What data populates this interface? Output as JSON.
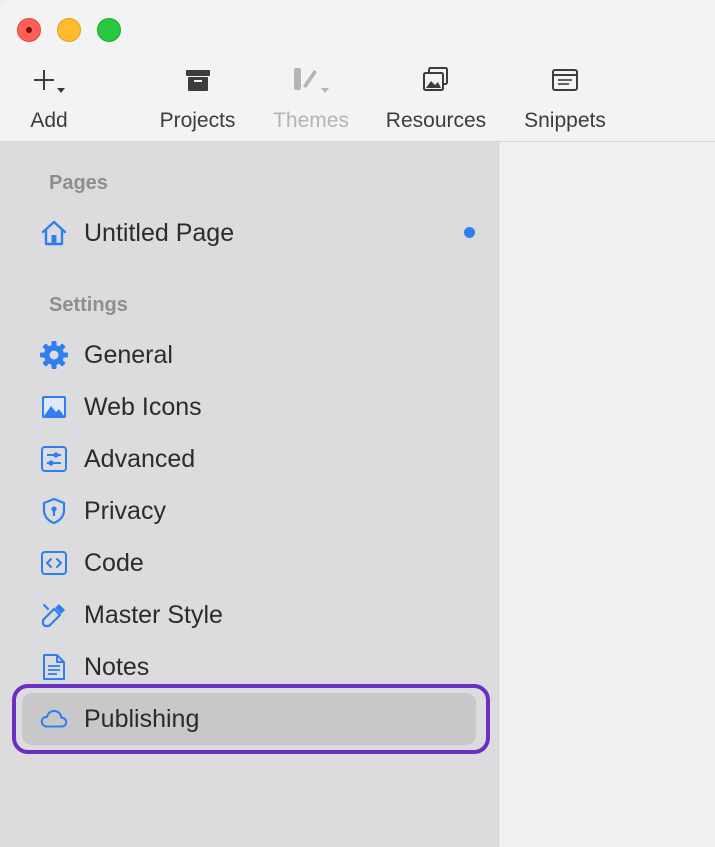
{
  "toolbar": {
    "add": {
      "label": "Add",
      "icon": "plus-icon"
    },
    "projects": {
      "label": "Projects",
      "icon": "archive-box-icon"
    },
    "themes": {
      "label": "Themes",
      "icon": "brush-icon"
    },
    "resources": {
      "label": "Resources",
      "icon": "images-icon"
    },
    "snippets": {
      "label": "Snippets",
      "icon": "snippet-icon"
    }
  },
  "sidebar": {
    "pages_title": "Pages",
    "pages": [
      {
        "label": "Untitled Page",
        "icon": "house-icon",
        "unsaved_indicator": true
      }
    ],
    "settings_title": "Settings",
    "settings": [
      {
        "label": "General",
        "icon": "gear-icon"
      },
      {
        "label": "Web Icons",
        "icon": "image-icon"
      },
      {
        "label": "Advanced",
        "icon": "sliders-icon"
      },
      {
        "label": "Privacy",
        "icon": "shield-icon"
      },
      {
        "label": "Code",
        "icon": "code-icon"
      },
      {
        "label": "Master Style",
        "icon": "eyedropper-icon"
      },
      {
        "label": "Notes",
        "icon": "document-icon"
      },
      {
        "label": "Publishing",
        "icon": "cloud-icon",
        "selected": true
      }
    ]
  },
  "colors": {
    "accent": "#2f7ff0",
    "highlight_outline": "#6a2fc4",
    "sidebar_bg": "#dcdcde",
    "selected_row": "#c8c8ca"
  }
}
